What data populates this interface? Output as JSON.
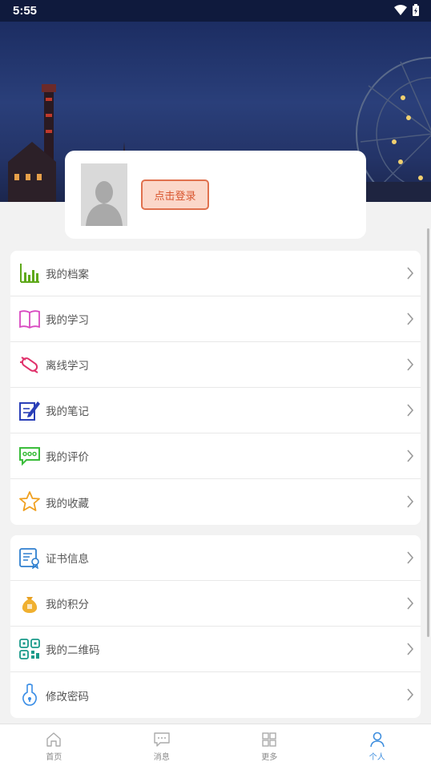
{
  "status_bar": {
    "time": "5:55"
  },
  "profile": {
    "login_label": "点击登录"
  },
  "menu_group_1": [
    {
      "label": "我的档案",
      "icon": "chart-bars-icon"
    },
    {
      "label": "我的学习",
      "icon": "book-icon"
    },
    {
      "label": "离线学习",
      "icon": "offline-icon"
    },
    {
      "label": "我的笔记",
      "icon": "note-edit-icon"
    },
    {
      "label": "我的评价",
      "icon": "comment-icon"
    },
    {
      "label": "我的收藏",
      "icon": "star-icon"
    }
  ],
  "menu_group_2": [
    {
      "label": "证书信息",
      "icon": "certificate-icon"
    },
    {
      "label": "我的积分",
      "icon": "money-bag-icon"
    },
    {
      "label": "我的二维码",
      "icon": "qr-code-icon"
    },
    {
      "label": "修改密码",
      "icon": "lock-icon"
    }
  ],
  "bottom_nav": [
    {
      "label": "首页",
      "icon": "home-icon"
    },
    {
      "label": "消息",
      "icon": "message-icon"
    },
    {
      "label": "更多",
      "icon": "grid-icon"
    },
    {
      "label": "个人",
      "icon": "person-icon"
    }
  ],
  "colors": {
    "accent": "#3e8ede",
    "login_border": "#e0714e",
    "login_fill": "#fbd7c9"
  }
}
